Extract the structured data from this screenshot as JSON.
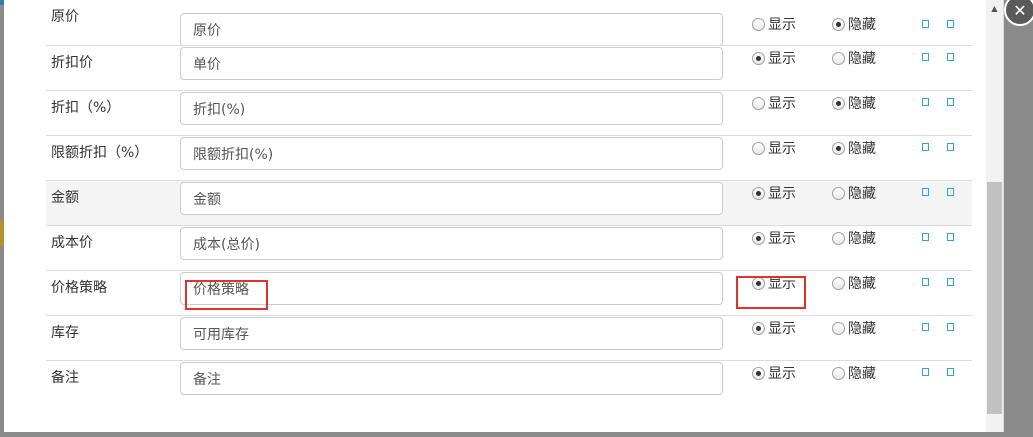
{
  "modal": {
    "close_icon": "close-icon",
    "radio_show_label": "显示",
    "radio_hide_label": "隐藏",
    "op_icons": [
      "square-icon",
      "square-icon"
    ],
    "rows": [
      {
        "label": "原价",
        "value": "原价",
        "visibility": "hide"
      },
      {
        "label": "折扣价",
        "value": "单价",
        "visibility": "show"
      },
      {
        "label": "折扣（%）",
        "value": "折扣(%)",
        "visibility": "hide"
      },
      {
        "label": "限额折扣（%）",
        "value": "限额折扣(%)",
        "visibility": "hide"
      },
      {
        "label": "金额",
        "value": "金额",
        "visibility": "show"
      },
      {
        "label": "成本价",
        "value": "成本(总价)",
        "visibility": "show"
      },
      {
        "label": "价格策略",
        "value": "价格策略",
        "visibility": "show"
      },
      {
        "label": "库存",
        "value": "可用库存",
        "visibility": "show"
      },
      {
        "label": "备注",
        "value": "备注",
        "visibility": "show"
      }
    ]
  },
  "colors": {
    "annotation": "#e0332c",
    "icon_blue": "#3aa0d0",
    "highlight_row": "#f4f4f4"
  }
}
